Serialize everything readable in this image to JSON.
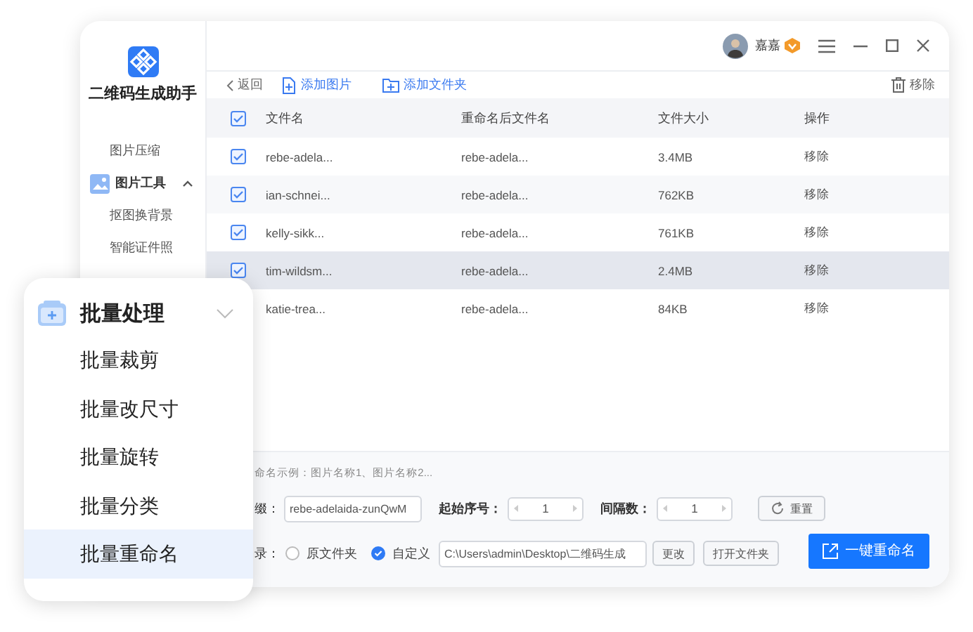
{
  "app": {
    "title": "二维码生成助手"
  },
  "sidebar": {
    "items": [
      {
        "label": "图片压缩",
        "kind": "item"
      },
      {
        "label": "图片工具",
        "kind": "group",
        "expanded": true
      },
      {
        "label": "抠图换背景",
        "kind": "sub"
      },
      {
        "label": "智能证件照",
        "kind": "sub"
      }
    ]
  },
  "user": {
    "name": "嘉嘉",
    "vip": true
  },
  "toolbar": {
    "back": "返回",
    "add_image": "添加图片",
    "add_folder": "添加文件夹",
    "remove": "移除"
  },
  "table": {
    "all_checked": true,
    "columns": [
      "文件名",
      "重命名后文件名",
      "文件大小",
      "操作"
    ],
    "rows": [
      {
        "checked": true,
        "selected": false,
        "name": "rebe-adela...",
        "renamed": "rebe-adela...",
        "size": "3.4MB",
        "action": "移除"
      },
      {
        "checked": true,
        "selected": false,
        "name": "ian-schnei...",
        "renamed": "rebe-adela...",
        "size": "762KB",
        "action": "移除"
      },
      {
        "checked": true,
        "selected": false,
        "name": "kelly-sikk...",
        "renamed": "rebe-adela...",
        "size": "761KB",
        "action": "移除"
      },
      {
        "checked": true,
        "selected": true,
        "name": "tim-wildsm...",
        "renamed": "rebe-adela...",
        "size": "2.4MB",
        "action": "移除"
      },
      {
        "selected": false,
        "name": "katie-trea...",
        "renamed": "rebe-adela...",
        "size": "84KB",
        "action": "移除"
      }
    ]
  },
  "rename": {
    "example": "命名示例：图片名称1、图片名称2...",
    "prefix_label": "缀：",
    "prefix_value": "rebe-adelaida-zunQwM",
    "start_label": "起始序号：",
    "start_value": "1",
    "step_label": "间隔数：",
    "step_value": "1",
    "reset": "重置",
    "dir_label": "录：",
    "dir_options": [
      {
        "label": "原文件夹",
        "selected": false
      },
      {
        "label": "自定义",
        "selected": true
      }
    ],
    "path": "C:\\Users\\admin\\Desktop\\二维码生成",
    "change": "更改",
    "open_folder": "打开文件夹",
    "submit": "一键重命名"
  },
  "popup": {
    "title": "批量处理",
    "expanded": true,
    "items": [
      {
        "label": "批量裁剪",
        "selected": false
      },
      {
        "label": "批量改尺寸",
        "selected": false
      },
      {
        "label": "批量旋转",
        "selected": false
      },
      {
        "label": "批量分类",
        "selected": false
      },
      {
        "label": "批量重命名",
        "selected": true
      }
    ]
  }
}
